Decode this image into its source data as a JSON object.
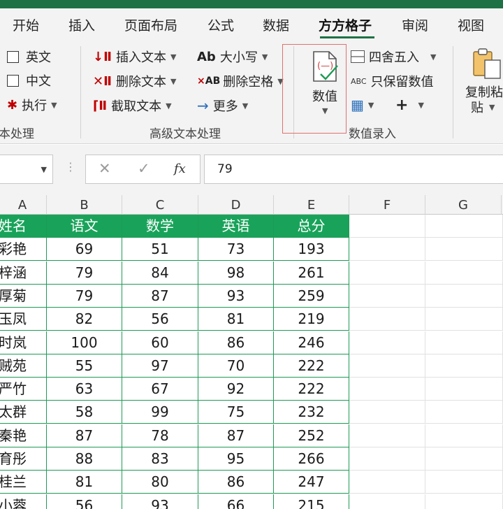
{
  "ribbon_tabs": [
    "开始",
    "插入",
    "页面布局",
    "公式",
    "数据",
    "方方格子",
    "审阅",
    "视图"
  ],
  "active_tab": "方方格子",
  "text_group": {
    "english": "英文",
    "chinese": "中文",
    "execute": "执行",
    "label": "本处理"
  },
  "advanced_group": {
    "insert_text": "插入文本",
    "delete_text": "删除文本",
    "cut_text": "截取文本",
    "case": "大小写",
    "delete_spaces": "删除空格",
    "more": "更多",
    "label": "高级文本处理",
    "case_icon": "Ab",
    "delete_spaces_icon": "AB"
  },
  "number_group": {
    "value_button": "数值",
    "round": "四舍五入",
    "keep_values": "只保留数值",
    "keep_values_icon": "ABC",
    "label": "数值录入",
    "plus": "+"
  },
  "paste_group": {
    "copy_paste_line1": "复制粘",
    "copy_paste_line2": "贴"
  },
  "formula_bar": {
    "value": "79",
    "fx": "fx"
  },
  "columns": [
    "A",
    "B",
    "C",
    "D",
    "E",
    "F",
    "G"
  ],
  "table": {
    "headers": [
      "姓名",
      "语文",
      "数学",
      "英语",
      "总分"
    ],
    "rows": [
      [
        "彩艳",
        "69",
        "51",
        "73",
        "193"
      ],
      [
        "梓涵",
        "79",
        "84",
        "98",
        "261"
      ],
      [
        "厚菊",
        "79",
        "87",
        "93",
        "259"
      ],
      [
        "玉凤",
        "82",
        "56",
        "81",
        "219"
      ],
      [
        "时岚",
        "100",
        "60",
        "86",
        "246"
      ],
      [
        "贼苑",
        "55",
        "97",
        "70",
        "222"
      ],
      [
        "严竹",
        "63",
        "67",
        "92",
        "222"
      ],
      [
        "太群",
        "58",
        "99",
        "75",
        "232"
      ],
      [
        "秦艳",
        "87",
        "78",
        "87",
        "252"
      ],
      [
        "育彤",
        "88",
        "83",
        "95",
        "266"
      ],
      [
        "桂兰",
        "81",
        "80",
        "86",
        "247"
      ],
      [
        "小蓉",
        "56",
        "93",
        "66",
        "215"
      ]
    ]
  },
  "colors": {
    "accent": "#1e7145",
    "table_header": "#19a35a",
    "table_border": "#1e9a55",
    "highlight_box": "#e07070"
  }
}
